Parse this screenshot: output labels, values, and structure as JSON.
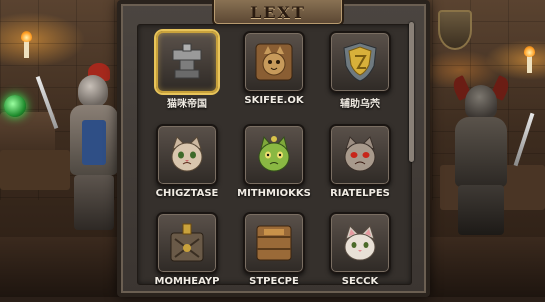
{
  "screen": {
    "title": "LEXT",
    "scroll_position": 0.0
  },
  "grid": {
    "items": [
      {
        "label": "猫咪帝国",
        "icon": "stone-anvil-icon",
        "selected": true
      },
      {
        "label": "SKIFEE.OK",
        "icon": "cat-face-crate-icon",
        "selected": false
      },
      {
        "label": "辅助乌茓",
        "icon": "golden-shield-icon",
        "selected": false
      },
      {
        "label": "CHIGZTASE",
        "icon": "cat-face-icon",
        "selected": false
      },
      {
        "label": "MITHMIOKKS",
        "icon": "green-cat-face-icon",
        "selected": false
      },
      {
        "label": "RIATELPES",
        "icon": "red-eyed-cat-face-icon",
        "selected": false
      },
      {
        "label": "MOMHEAYP",
        "icon": "potion-crate-icon",
        "selected": false
      },
      {
        "label": "STPECPE",
        "icon": "wooden-crate-icon",
        "selected": false
      },
      {
        "label": "SECCK",
        "icon": "pink-cat-face-icon",
        "selected": false
      }
    ]
  },
  "colors": {
    "selected_border": "#e8c45a",
    "label_text": "#f1ece4",
    "panel_bg": "#35302c"
  }
}
